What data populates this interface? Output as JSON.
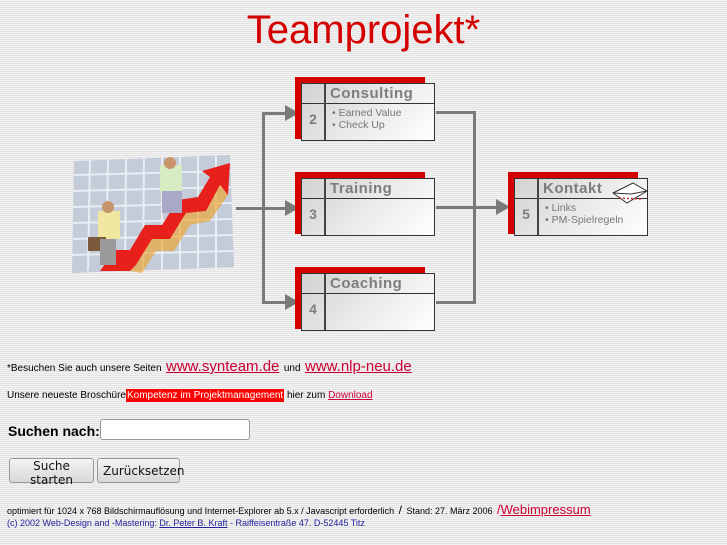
{
  "header": {
    "title": "Teamprojekt*"
  },
  "diagram": {
    "boxes": [
      {
        "number": "2",
        "title": "Consulting",
        "items": [
          "• Earned Value",
          "• Check Up"
        ]
      },
      {
        "number": "3",
        "title": "Training",
        "items": []
      },
      {
        "number": "4",
        "title": "Coaching",
        "items": []
      },
      {
        "number": "5",
        "title": "Kontakt",
        "items": [
          "• Links",
          "• PM-Spielregeln"
        ],
        "icon": "envelope-icon"
      }
    ],
    "image": "business-men-climbing-red-arrow-chart"
  },
  "visit": {
    "prefix": "*Besuchen Sie auch unsere Seiten",
    "link1": "www.synteam.de",
    "middle": "und",
    "link2": "www.nlp-neu.de"
  },
  "brochure": {
    "prefix": "Unsere neueste Broschüre",
    "highlight": "Kompetenz im Projektmanagement",
    "middle": "hier zum",
    "link": "Download"
  },
  "search": {
    "label": "Suchen nach:",
    "value": "",
    "placeholder": "",
    "submit_label": "Suche starten",
    "reset_label": "Zurücksetzen"
  },
  "footer": {
    "line1": "optimiert für 1024 x 768 Bildschirmauflösung und Internet-Explorer ab 5.x / Javascript erforderlich",
    "separator": "/",
    "stand": "Stand: 27. März 2006",
    "impressum_prefix": "/",
    "impressum_link": "Webimpressum",
    "copyright_prefix": "(c) 2002  Web-Design and -Mastering:",
    "author_link": "Dr. Peter B. Kraft",
    "address": "-   Raiffeisentraße 47. D-52445 Titz"
  },
  "colors": {
    "accent": "#d40000",
    "link": "#cc0033",
    "footer_text": "#22229a"
  }
}
